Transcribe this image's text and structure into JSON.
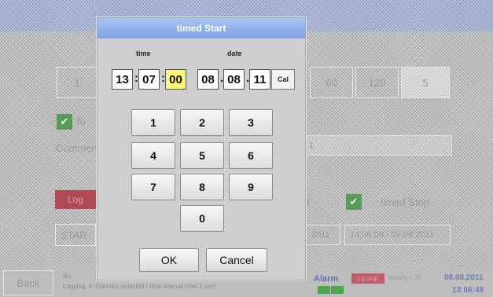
{
  "background": {
    "tabs": [
      "1",
      "60",
      "120",
      "5"
    ],
    "checkbox_label": "fo",
    "comment_label": "Commen",
    "comment_value": "t 1",
    "logger_label": "Log",
    "start_label": "STAR",
    "stop_label_prefix": "t",
    "timed_stop_label": "timed Stop",
    "start_date_value": "2011",
    "stop_datetime_value": "14:06:00 - 08.08.2011",
    "back_label": "Back",
    "status_line1": "Ru",
    "status_line2": "Logging:  4 channels selected / time interval (min 1 sec)",
    "alarm_label": "Alarm",
    "lgstop_label": "Lg stop",
    "capacity_label": "apacity = 15",
    "date": "08.08.2011",
    "time": "13:06:48",
    "check_mark": "✔"
  },
  "dialog": {
    "title": "timed Start",
    "time_label": "time",
    "date_label": "date",
    "hours": "13",
    "minutes": "07",
    "seconds": "00",
    "day": "08",
    "month": "08",
    "year": "11",
    "time_sep": ":",
    "date_sep": ".",
    "cal_label": "Cal",
    "keys": [
      "1",
      "2",
      "3",
      "4",
      "5",
      "6",
      "7",
      "8",
      "9",
      "0"
    ],
    "ok_label": "OK",
    "cancel_label": "Cancel",
    "active_field": "seconds",
    "active_color": "#fbf67a"
  }
}
